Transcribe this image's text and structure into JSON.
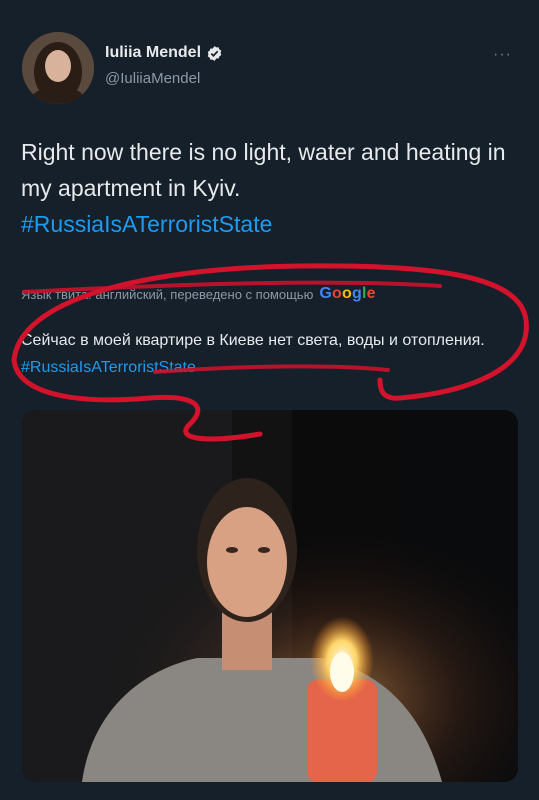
{
  "author": {
    "name": "Iuliia Mendel",
    "handle": "@IuliiaMendel",
    "verified": true
  },
  "menu": {
    "more_label": "···"
  },
  "tweet": {
    "text_main": "Right now there is no light, water and heating in my apartment in Kyiv.",
    "hashtag": "#RussiaIsATerroristState"
  },
  "translation": {
    "notice": "Язык твита: английский, переведено с помощью",
    "provider": "Google",
    "text_main": "Сейчас в моей квартире в Киеве нет света, воды и отопления.",
    "hashtag": "#RussiaIsATerroristState"
  },
  "colors": {
    "background": "#15202b",
    "link": "#1d9bf0",
    "secondary_text": "#8b98a5",
    "annotation": "#d3122b"
  },
  "icons": [
    "verified-badge-icon",
    "more-options-icon",
    "google-logo"
  ]
}
